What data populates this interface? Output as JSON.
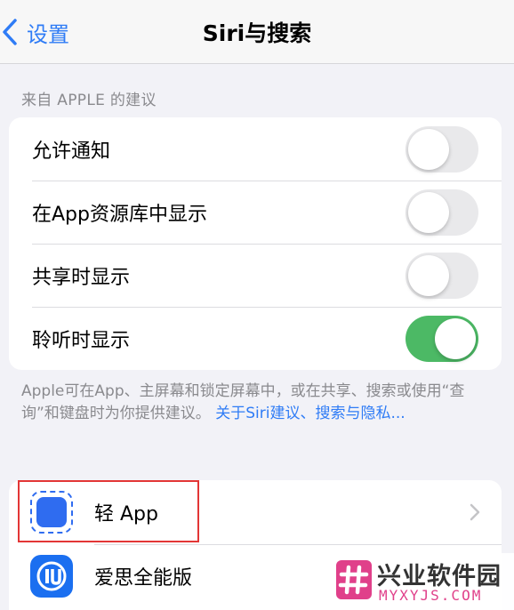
{
  "nav": {
    "back_label": "设置",
    "title": "Siri与搜索"
  },
  "section": {
    "header": "来自 APPLE 的建议",
    "rows": [
      {
        "label": "允许通知",
        "on": false
      },
      {
        "label": "在App资源库中显示",
        "on": false
      },
      {
        "label": "共享时显示",
        "on": false
      },
      {
        "label": "聆听时显示",
        "on": true
      }
    ],
    "footer_text": "Apple可在App、主屏幕和锁定屏幕中，或在共享、搜索或使用“查询”和键盘时为你提供建议。",
    "footer_link": "关于Siri建议、搜索与隐私..."
  },
  "apps": [
    {
      "name": "轻 App",
      "icon": "dashed-square-app-icon"
    },
    {
      "name": "爱思全能版",
      "icon": "aisi-app-icon"
    }
  ],
  "watermark": {
    "name": "兴业软件园",
    "url": "MYXYJS.COM"
  },
  "colors": {
    "accent": "#2f7cf6",
    "toggle_on": "#4cb965",
    "highlight": "#e33636"
  }
}
